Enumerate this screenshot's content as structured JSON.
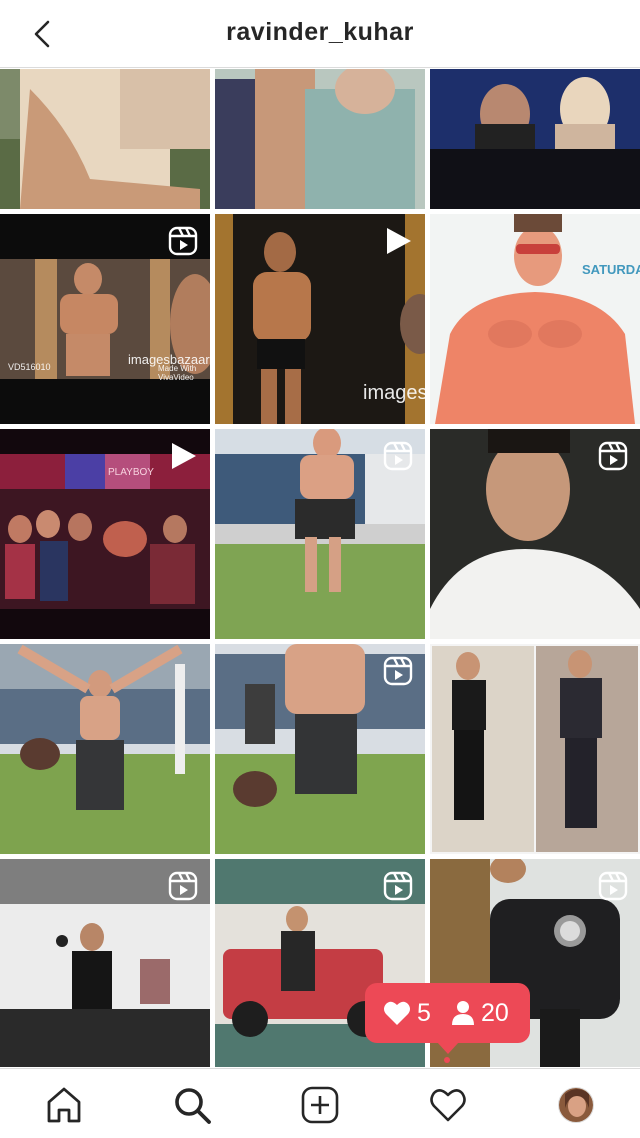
{
  "header": {
    "username": "ravinder_kuhar"
  },
  "grid": {
    "tiles": [
      {
        "type": "photo"
      },
      {
        "type": "photo"
      },
      {
        "type": "photo"
      },
      {
        "type": "reel",
        "overlay_texts": [
          "VD516010",
          "imagesbazaar",
          "Made With VivaVideo"
        ]
      },
      {
        "type": "video",
        "overlay_texts": [
          "images"
        ]
      },
      {
        "type": "photo",
        "overlay_texts": [
          "SATURDAY"
        ]
      },
      {
        "type": "video",
        "overlay_texts": [
          "PLAYBOY"
        ]
      },
      {
        "type": "reel"
      },
      {
        "type": "reel"
      },
      {
        "type": "photo"
      },
      {
        "type": "reel"
      },
      {
        "type": "photo"
      },
      {
        "type": "photo"
      },
      {
        "type": "reel"
      },
      {
        "type": "reel"
      }
    ]
  },
  "notification": {
    "likes": "5",
    "followers": "20"
  },
  "bottom_nav": {
    "items": [
      "home-icon",
      "search-icon",
      "new-post-icon",
      "activity-icon",
      "profile-avatar"
    ]
  },
  "colors": {
    "accent": "#ed4956",
    "text": "#262626",
    "divider": "#dbdbdb"
  }
}
